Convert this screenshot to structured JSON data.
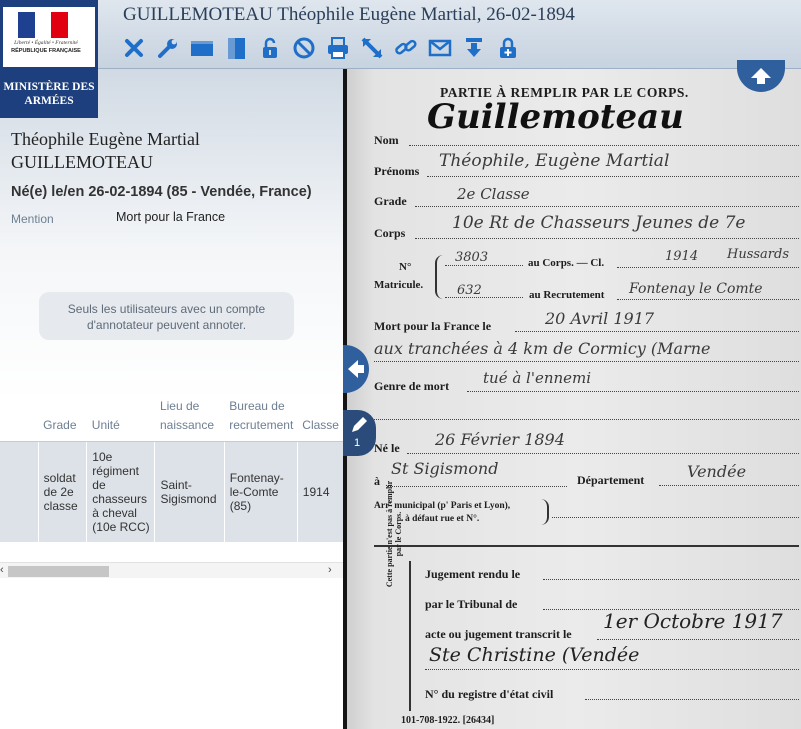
{
  "header": {
    "title": "GUILLEMOTEAU Théophile Eugène Martial, 26-02-1894",
    "logo": {
      "motto": "Liberté • Égalité • Fraternité",
      "republic": "RÉPUBLIQUE FRANÇAISE",
      "ministry": "MINISTÈRE DES ARMÉES"
    },
    "toolbar": [
      {
        "name": "close",
        "icon": "close-icon"
      },
      {
        "name": "settings",
        "icon": "wrench-icon"
      },
      {
        "name": "layout-horizontal",
        "icon": "layout-horizontal-icon"
      },
      {
        "name": "layout-vertical",
        "icon": "layout-vertical-icon"
      },
      {
        "name": "unlock",
        "icon": "lock-open-icon"
      },
      {
        "name": "block",
        "icon": "no-entry-icon"
      },
      {
        "name": "print",
        "icon": "printer-icon"
      },
      {
        "name": "fullscreen",
        "icon": "expand-arrow-icon"
      },
      {
        "name": "link",
        "icon": "link-icon"
      },
      {
        "name": "email",
        "icon": "envelope-icon"
      },
      {
        "name": "download",
        "icon": "download-icon"
      },
      {
        "name": "lock",
        "icon": "lock-icon"
      }
    ]
  },
  "person": {
    "first_names": "Théophile Eugène Martial",
    "surname": "GUILLEMOTEAU",
    "birth": "Né(e) le/en 26-02-1894 (85 - Vendée, France)",
    "mention_label": "Mention",
    "mention_value": "Mort pour la France"
  },
  "annotation_note": "Seuls les utilisateurs avec un compte d'annotateur peuvent annoter.",
  "table": {
    "headers": [
      "",
      "Grade",
      "Unité",
      "Lieu de naissance",
      "Bureau de recrutement",
      "Classe"
    ],
    "rows": [
      [
        "",
        "soldat de 2e classe",
        "10e régiment de chasseurs à cheval (10e RCC)",
        "Saint-Sigismond",
        "Fontenay-le-Comte (85)",
        "1914"
      ]
    ]
  },
  "scrollbar": {
    "left_arrow": "‹",
    "right_arrow": "›"
  },
  "viewer": {
    "annotation_count": "1",
    "document": {
      "header": "PARTIE À REMPLIR PAR LE CORPS.",
      "labels": {
        "nom": "Nom",
        "prenoms": "Prénoms",
        "grade": "Grade",
        "corps": "Corps",
        "no": "N°",
        "matricule": "Matricule.",
        "au_corps": "au Corps. — Cl.",
        "au_recrutement": "au Recrutement",
        "mort": "Mort pour la France le",
        "genre": "Genre de mort",
        "ne_le": "Né le",
        "a": "à",
        "departement": "Département",
        "arr1": "Arr' municipal (p' Paris et Lyon),",
        "arr2": "à défaut rue et N°.",
        "side": "Cette partie n'est pas à remplir par le Corps.",
        "jugement": "Jugement rendu le",
        "tribunal": "par le Tribunal de",
        "acte": "acte ou jugement transcrit le",
        "registre": "N° du registre d'état civil",
        "footer": "101-708-1922.   [26434]"
      },
      "handwriting": {
        "nom": "Guillemoteau",
        "prenoms": "Théophile, Eugène Martial",
        "grade": "2e Classe",
        "corps": "10e Rt de Chasseurs Jeunes de 7e",
        "no": "3803",
        "cl": "1914",
        "unit": "Hussards",
        "matricule": "632",
        "recrutement": "Fontenay le Comte",
        "mort": "20 Avril 1917",
        "lieu": "aux tranchées à 4 km de Cormicy (Marne",
        "genre": "tué à l'ennemi",
        "ne_le": "26 Février 1894",
        "lieu_naissance": "St Sigismond",
        "departement": "Vendée",
        "transcrit": "1er Octobre 1917",
        "commune": "Ste Christine (Vendée"
      }
    }
  },
  "colors": {
    "brand_blue": "#1d3f7e",
    "toolbar_icon": "#1f6fc9",
    "nav_button": "#2f5f9d"
  }
}
